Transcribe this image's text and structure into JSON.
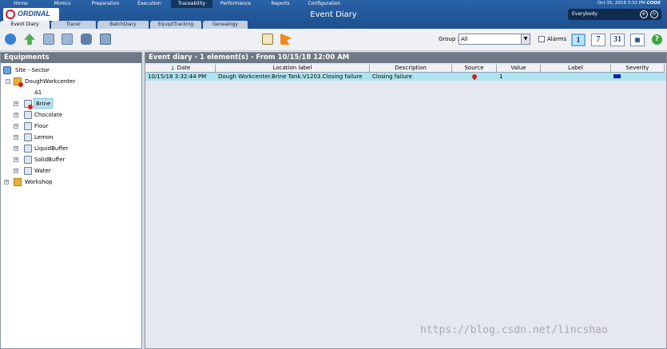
{
  "app": {
    "logo_text": "ORDINAL",
    "page_title": "Event Diary",
    "datetime": "Oct 15, 2018 3:32 PM",
    "brand": "COOX",
    "user": "Everybody"
  },
  "topnav": [
    "Home",
    "Mimics",
    "Preparation",
    "Execution",
    "Traceability",
    "Performance",
    "Reports",
    "Configuration"
  ],
  "topnav_active": "Traceability",
  "tabs": [
    "Event Diary",
    "Tracer",
    "BatchDiary",
    "EquiptTracking",
    "Genealogy"
  ],
  "tabs_active": "Event Diary",
  "toolbar": {
    "group_label": "Group :",
    "group_value": "All",
    "alarms_label": "Alarms",
    "cal_day": "1",
    "cal_week": "7",
    "cal_month": "31",
    "help": "?"
  },
  "equipments": {
    "title": "Equipments",
    "root": "Site - Sector",
    "workcenter": "DoughWorkcenter",
    "items": [
      "A1",
      "Brine",
      "Chocolate",
      "Flour",
      "Lemon",
      "LiquidBuffer",
      "SolidBuffer",
      "Water"
    ],
    "workshop": "Workshop",
    "selected": "Brine"
  },
  "diary": {
    "title": "Event diary - 1 element(s) - From 10/15/18 12:00 AM",
    "columns": [
      "Date",
      "Location label",
      "Description",
      "Source",
      "Value",
      "Label",
      "Severity"
    ],
    "rows": [
      {
        "date": "10/15/18 3:32:44 PM",
        "location": "Dough Workcenter.Brine Tank.V1203.Closing failure",
        "description": "Closing failure",
        "value": "1",
        "label": ""
      }
    ]
  },
  "watermark": "https://blog.csdn.net/lincshao",
  "colors": {
    "header_blue": "#1d4f8e",
    "row_highlight": "#aee4ef",
    "alarm_red": "#d21f1f",
    "severity_blue": "#0d1fb5"
  }
}
